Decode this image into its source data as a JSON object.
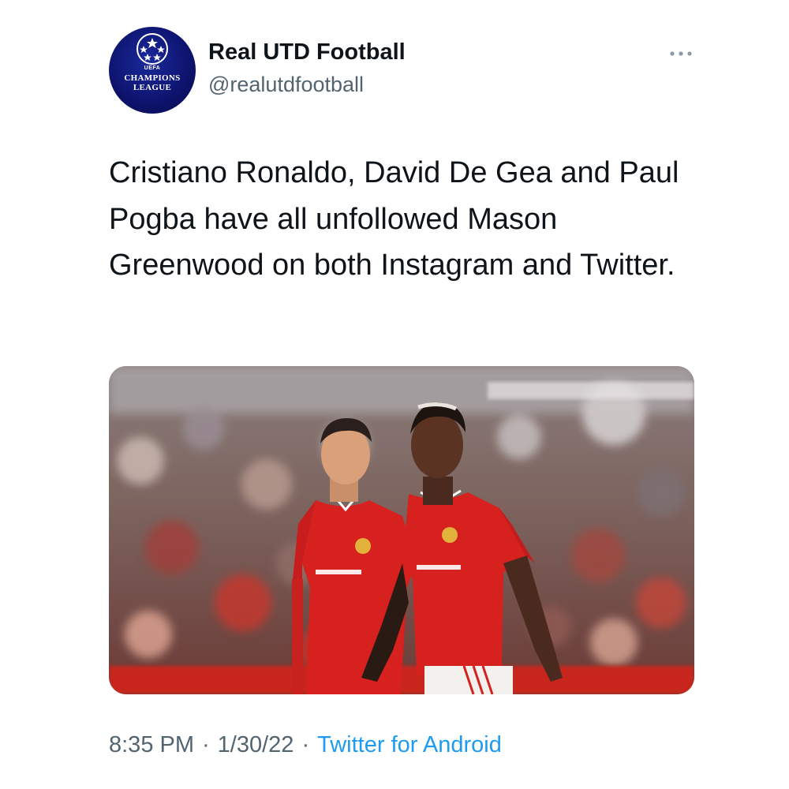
{
  "tweet": {
    "author": {
      "display_name": "Real UTD Football",
      "handle": "@realutdfootball",
      "avatar": {
        "icon": "champions-league-logo",
        "line_top": "UEFA",
        "line1": "CHAMPIONS",
        "line2": "LEAGUE"
      }
    },
    "menu_icon": "more-horizontal-icon",
    "text": "Cristiano Ronaldo, David De Gea and Paul Pogba have all unfollowed Mason Greenwood on both Instagram and Twitter.",
    "media": {
      "type": "photo",
      "subject": "two-footballers-red-kits-stadium"
    },
    "time": "8:35 PM",
    "separator": "·",
    "date": "1/30/22",
    "source": "Twitter for Android",
    "colors": {
      "text": "#0f1419",
      "secondary": "#536471",
      "link": "#1d9bf0",
      "kit_red": "#d7211f"
    }
  }
}
